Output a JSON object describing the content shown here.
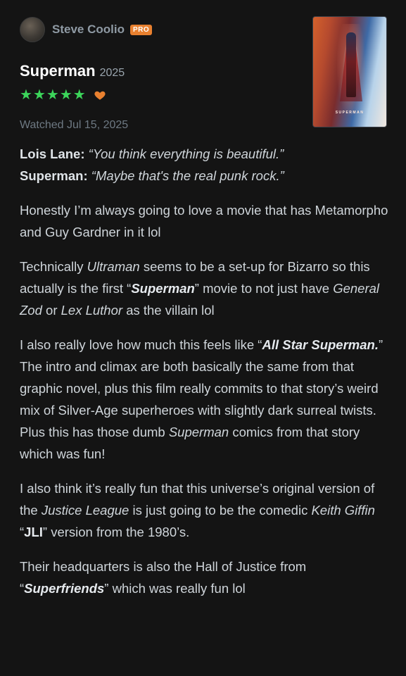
{
  "user": {
    "name": "Steve Coolio",
    "badge": "PRO"
  },
  "film": {
    "title": "Superman",
    "year": "2025",
    "poster_text": "SUPERMAN"
  },
  "rating": {
    "stars": 5,
    "liked": true,
    "star_color": "#3cd55a",
    "heart_color": "#e8802f",
    "star_glyph": "★"
  },
  "watched": "Watched Jul 15, 2025",
  "quotes": [
    {
      "speaker": "Lois Lane:",
      "text": "“You think everything is beautiful.”"
    },
    {
      "speaker": "Superman:",
      "text": "“Maybe that's the real punk rock.”"
    }
  ],
  "paragraphs": [
    [
      {
        "t": "Honestly I’m always going to love a movie that has Metamorpho and Guy Gardner in it lol",
        "s": ""
      }
    ],
    [
      {
        "t": "Technically ",
        "s": ""
      },
      {
        "t": "Ultraman",
        "s": "i"
      },
      {
        "t": " seems to be a set-up for Bizarro so this actually is the first “",
        "s": ""
      },
      {
        "t": "Superman",
        "s": "bi"
      },
      {
        "t": "” movie to not just have ",
        "s": ""
      },
      {
        "t": "General Zod",
        "s": "i"
      },
      {
        "t": " or ",
        "s": ""
      },
      {
        "t": "Lex Luthor",
        "s": "i"
      },
      {
        "t": " as the villain lol",
        "s": ""
      }
    ],
    [
      {
        "t": "I also really love how much this feels like “",
        "s": ""
      },
      {
        "t": "All Star Superman.",
        "s": "bi"
      },
      {
        "t": "”  The intro and climax are both basically the same from that graphic novel, plus this film really commits to that story’s weird mix of Silver-Age superheroes with slightly dark surreal twists.  Plus this has those dumb ",
        "s": ""
      },
      {
        "t": "Superman",
        "s": "i"
      },
      {
        "t": " comics from that story which was fun!",
        "s": ""
      }
    ],
    [
      {
        "t": "I also think it’s really fun that this universe’s original version of the ",
        "s": ""
      },
      {
        "t": "Justice League",
        "s": "i"
      },
      {
        "t": " is just going to be the comedic ",
        "s": ""
      },
      {
        "t": "Keith Giffin",
        "s": "i"
      },
      {
        "t": " “",
        "s": ""
      },
      {
        "t": "JLI",
        "s": "b"
      },
      {
        "t": "” version from the 1980’s.",
        "s": ""
      }
    ],
    [
      {
        "t": "Their headquarters is also the Hall of Justice from “",
        "s": ""
      },
      {
        "t": "Superfriends",
        "s": "bi"
      },
      {
        "t": "” which was really fun lol",
        "s": ""
      }
    ]
  ]
}
